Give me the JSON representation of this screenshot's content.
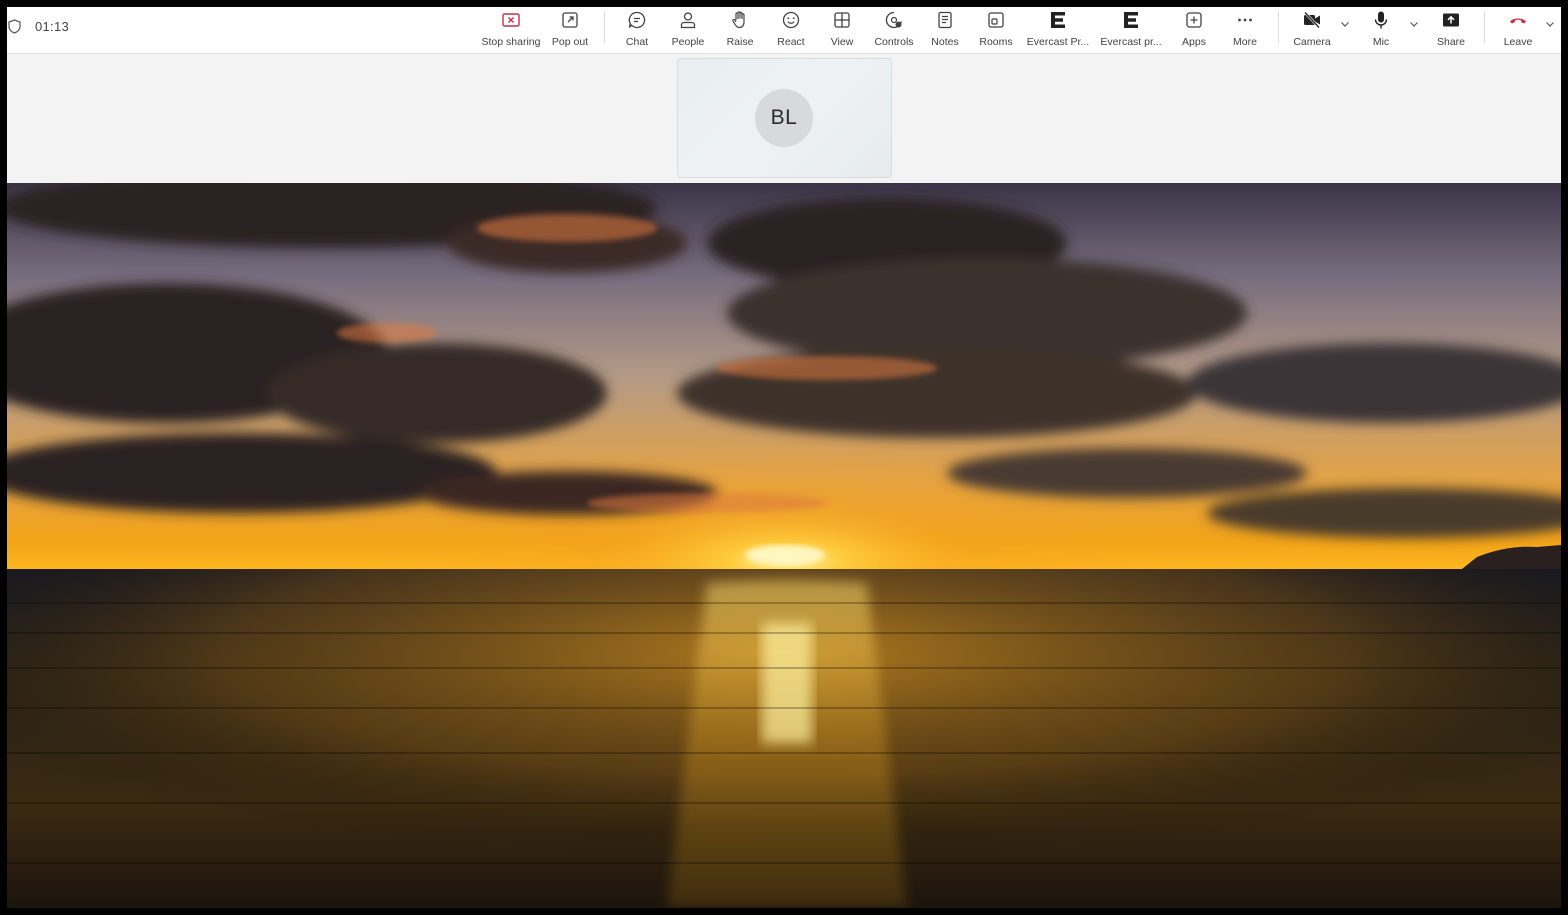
{
  "meeting": {
    "timer": "01:13"
  },
  "toolbar": {
    "buttons": [
      {
        "label": "Stop sharing",
        "icon": "stop-sharing-icon"
      },
      {
        "label": "Pop out",
        "icon": "pop-out-icon"
      },
      {
        "label": "Chat",
        "icon": "chat-icon"
      },
      {
        "label": "People",
        "icon": "people-icon"
      },
      {
        "label": "Raise",
        "icon": "raise-hand-icon"
      },
      {
        "label": "React",
        "icon": "react-icon"
      },
      {
        "label": "View",
        "icon": "view-icon"
      },
      {
        "label": "Controls",
        "icon": "controls-icon"
      },
      {
        "label": "Notes",
        "icon": "notes-icon"
      },
      {
        "label": "Rooms",
        "icon": "rooms-icon"
      },
      {
        "label": "Evercast Pr...",
        "icon": "evercast-icon"
      },
      {
        "label": "Evercast pr...",
        "icon": "evercast-icon"
      },
      {
        "label": "Apps",
        "icon": "apps-icon"
      },
      {
        "label": "More",
        "icon": "more-icon"
      },
      {
        "label": "Camera",
        "icon": "camera-off-icon"
      },
      {
        "label": "Mic",
        "icon": "mic-icon"
      },
      {
        "label": "Share",
        "icon": "share-icon"
      },
      {
        "label": "Leave",
        "icon": "leave-icon"
      }
    ]
  },
  "participant": {
    "initials": "BL"
  },
  "colors": {
    "leave_red": "#c4314b",
    "stop_red": "#c4314b",
    "icon_gray": "#424242"
  }
}
